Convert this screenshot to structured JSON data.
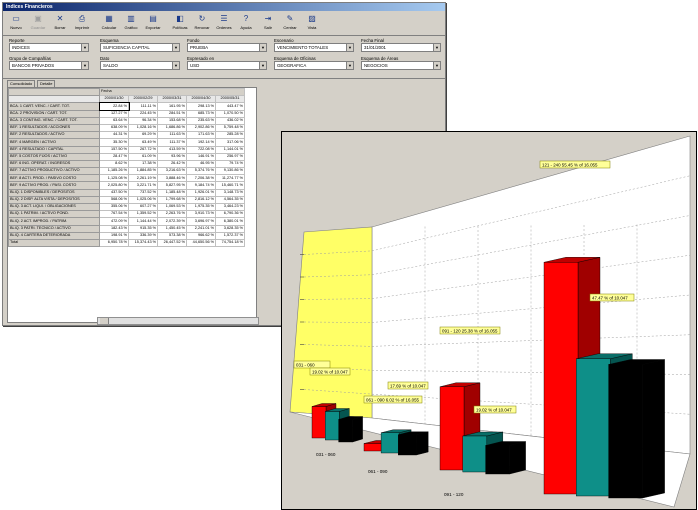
{
  "window": {
    "title": "Indices Financieros"
  },
  "toolbar": [
    {
      "label": "Nuevo",
      "icon": "new-icon",
      "disabled": false
    },
    {
      "label": "Guardar",
      "icon": "save-icon",
      "disabled": true
    },
    {
      "label": "Borrar",
      "icon": "delete-icon",
      "disabled": false
    },
    {
      "label": "Imprimir",
      "icon": "print-icon",
      "disabled": false
    },
    {
      "label": "Calcular",
      "icon": "calculator-icon",
      "disabled": false
    },
    {
      "label": "Gráfico",
      "icon": "chart-icon",
      "disabled": false
    },
    {
      "label": "Exportar",
      "icon": "export-icon",
      "disabled": false
    },
    {
      "label": "Políticas",
      "icon": "policy-icon",
      "disabled": false
    },
    {
      "label": "Renovar",
      "icon": "refresh-icon",
      "disabled": false
    },
    {
      "label": "Ordenes",
      "icon": "orders-icon",
      "disabled": false
    },
    {
      "label": "Ayuda",
      "icon": "help-icon",
      "disabled": false
    },
    {
      "label": "Salir",
      "icon": "exit-icon",
      "disabled": false
    },
    {
      "label": "Centrar",
      "icon": "center-icon",
      "disabled": false
    },
    {
      "label": "Vista",
      "icon": "view-icon",
      "disabled": false
    }
  ],
  "filters": {
    "reporte": {
      "label": "Reporte",
      "value": "INDICES"
    },
    "esquema": {
      "label": "Esquema",
      "value": "SUFICIENCIA CAPITAL"
    },
    "fondo": {
      "label": "Fondo",
      "value": "PRUEBA"
    },
    "escenario": {
      "label": "Escenario",
      "value": "VENCIMIENTO TOTALES"
    },
    "fecha_final": {
      "label": "Fecha Final",
      "value": "31/01/2001"
    },
    "grupo": {
      "label": "Grupo de Compañías",
      "value": "BANCOS PRIVADOS"
    },
    "dato": {
      "label": "Dato",
      "value": "SALDO"
    },
    "expresado": {
      "label": "Expresado en",
      "value": "USD"
    },
    "esquema_oficina": {
      "label": "Esquema de Oficinas",
      "value": "GEOGRAFICA"
    },
    "esquema_area": {
      "label": "Esquema de Áreas",
      "value": "NEGOCIOS"
    }
  },
  "tabs": [
    "Consolidado",
    "Detalle"
  ],
  "grid": {
    "group_label": "Fecha",
    "dates": [
      "2000/01/30",
      "2000/02/29",
      "2000/03/31",
      "2000/04/30",
      "2000/05/31"
    ],
    "rows": [
      {
        "label": "BCA. 1 CART. VENC. / CART. TOT.",
        "values": [
          "22.84 %",
          "111.11 %",
          "161.95 %",
          "298.13 %",
          "443.47 %"
        ]
      },
      {
        "label": "BCA. 2 PROVISION / CART. TOT.",
        "values": [
          "127.27 %",
          "224.45 %",
          "284.51 %",
          "685.73 %",
          "1,070.50 %"
        ]
      },
      {
        "label": "BCA. 3 CONTING. VENC. / CART. TOT.",
        "values": [
          "63.64 %",
          "96.34 %",
          "153.68 %",
          "235.63 %",
          "436.02 %"
        ]
      },
      {
        "label": "BEF. 1 RESULTADOS / ACCIONES",
        "values": [
          "638.09 %",
          "1,028.16 %",
          "1,686.86 %",
          "2,902.86 %",
          "5,759.48 %"
        ]
      },
      {
        "label": "BEF. 2 RESULTADOS / ACTIVO",
        "values": [
          "44.31 %",
          "69.29 %",
          "111.63 %",
          "171.63 %",
          "285.28 %"
        ]
      },
      {
        "label": "BEF. 4 MARGEN / ACTIVO",
        "values": [
          "35.30 %",
          "63.49 %",
          "111.37 %",
          "192.14 %",
          "317.06 %"
        ]
      },
      {
        "label": "BEF. 4 RESULTADO / CAPITAL",
        "values": [
          "157.50 %",
          "267.72 %",
          "413.59 %",
          "722.08 %",
          "1,144.01 %"
        ]
      },
      {
        "label": "BEF. 5 COSTOS FIJOS / ACTIVO",
        "values": [
          "28.47 %",
          "61.09 %",
          "93.96 %",
          "146.91 %",
          "256.97 %"
        ]
      },
      {
        "label": "BEF. 6 ING. OPERAT. / INGRESOS",
        "values": [
          "8.62 %",
          "17.38 %",
          "26.42 %",
          "46.95 %",
          "79.74 %"
        ]
      },
      {
        "label": "BEF. 7 ACTIVO PRODUCTIVO / ACTIVO",
        "values": [
          "1,185.26 %",
          "1,884.85 %",
          "3,216.63 %",
          "5,374.76 %",
          "9,130.86 %"
        ]
      },
      {
        "label": "BEF. 8 ACTI. PROD. / PASIVO COSTO",
        "values": [
          "1,125.08 %",
          "2,261.19 %",
          "3,888.46 %",
          "7,206.38 %",
          "11,274.77 %"
        ]
      },
      {
        "label": "BEF. 9 ACTIVO PROD. / PASI. COSTO",
        "values": [
          "2,025.80 %",
          "3,221.71 %",
          "5,827.95 %",
          "9,184.74 %",
          "15,460.71 %"
        ]
      },
      {
        "label": "BLIQ. 1 DISPONIBLES / DEPOSITOS",
        "values": [
          "437.50 %",
          "737.52 %",
          "1,185.48 %",
          "1,926.01 %",
          "3,148.73 %"
        ]
      },
      {
        "label": "BLIQ. 2 DISP. ALTA VISTA / DEPOSITOS",
        "values": [
          "568.06 %",
          "1,025.06 %",
          "1,799.68 %",
          "2,816.12 %",
          "4,564.35 %"
        ]
      },
      {
        "label": "BLIQ. 3 ACT. LIQUI. / OBLIGACIONES",
        "values": [
          "355.06 %",
          "607.27 %",
          "1,069.53 %",
          "1,975.35 %",
          "3,464.23 %"
        ]
      },
      {
        "label": "BLIQ. 1 PATRIM. / ACTIVO POND.",
        "values": [
          "767.54 %",
          "1,359.52 %",
          "2,263.76 %",
          "3,910.73 %",
          "6,790.36 %"
        ]
      },
      {
        "label": "BLIQ. 2 ACT. IMPROD. / PATRIM.",
        "values": [
          "472.09 %",
          "1,144.44 %",
          "2,072.39 %",
          "3,696.97 %",
          "6,380.01 %"
        ]
      },
      {
        "label": "BLIQ. 3 PATRI. TECNICO / ACTIVO",
        "values": [
          "182.43 %",
          "915.35 %",
          "1,450.45 %",
          "2,241.01 %",
          "3,628.35 %"
        ]
      },
      {
        "label": "BLIQ. 4 CARTERA DETERIORADA",
        "values": [
          "198.91 %",
          "336.39 %",
          "573.38 %",
          "966.62 %",
          "1,572.37 %"
        ]
      },
      {
        "label": "Total",
        "values": [
          "6,950.78 %",
          "15,374.43 %",
          "26,447.52 %",
          "44,650.56 %",
          "74,754.18 %"
        ]
      }
    ]
  },
  "chart_data": {
    "type": "bar",
    "title": "",
    "xlabel": "",
    "ylabel": "",
    "three_d": true,
    "categories": [
      "031 - 060",
      "061 - 090",
      "091 - 120",
      "121 - 240"
    ],
    "series": [
      {
        "values": [
          42,
          10,
          111,
          309
        ],
        "color": "#ff0000"
      },
      {
        "values": [
          38,
          27,
          48,
          183
        ],
        "color": "#008080"
      },
      {
        "values": [
          30,
          27,
          38,
          178
        ],
        "color": "#000000"
      }
    ],
    "annotations": [
      "031 - 060",
      "19.02 % of 10.047",
      "061 - 090 6.02 % of 16.055",
      "17.69 % of 10.047",
      "091 - 120 25.38 % of 16.055",
      "19.02 % of 10.047",
      "121 - 240 55.45 % of 16.055",
      "47.47 % of 10.047"
    ],
    "ylim": [
      0,
      400
    ],
    "grid": true
  }
}
